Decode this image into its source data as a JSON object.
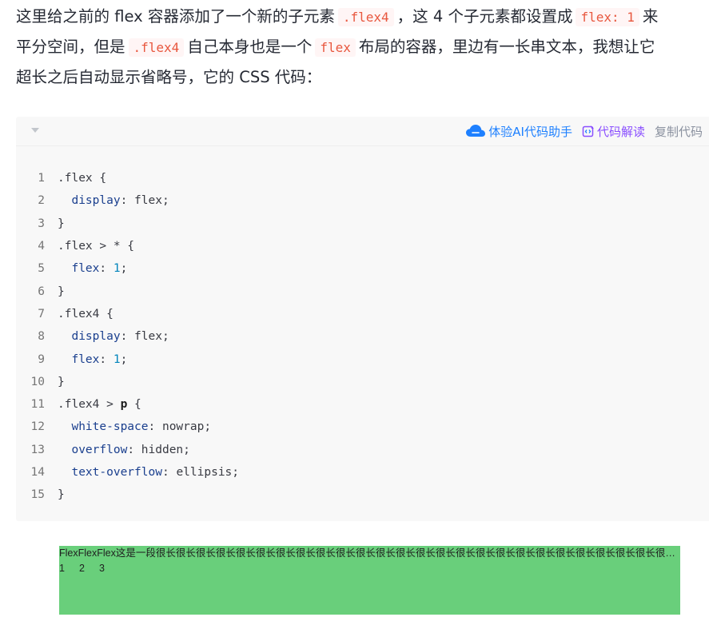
{
  "article": {
    "line1": {
      "t1": "这里给之前的 flex 容器添加了一个新的子元素",
      "code1": ".flex4",
      "t2": "，这 4 个子元素都设置成",
      "code2": "flex: 1",
      "t3": "来"
    },
    "line2": {
      "t1": "平分空间，但是",
      "code1": ".flex4",
      "t2": "自己本身也是一个",
      "code2": "flex",
      "t3": "布局的容器，里边有一长串文本，我想让它"
    },
    "line3": {
      "t1": "超长之后自动显示省略号，它的 CSS 代码："
    }
  },
  "code_toolbar": {
    "collapse_icon": "caret-down-icon",
    "ai_icon": "cloud-icon",
    "ai_label": "体验AI代码助手",
    "explain_icon": "code-edit-icon",
    "explain_label": "代码解读",
    "copy_label": "复制代码",
    "colors": {
      "ai": "#1e80ff",
      "explain": "#8a4fff",
      "copy": "#8a919f"
    }
  },
  "code": {
    "lines": [
      {
        "n": "1",
        "a": ".flex {"
      },
      {
        "n": "2",
        "ind": "  ",
        "prop": "display",
        "sep": ": ",
        "val": "flex",
        "end": ";"
      },
      {
        "n": "3",
        "a": "}"
      },
      {
        "n": "4",
        "a": ".flex > * {"
      },
      {
        "n": "5",
        "ind": "  ",
        "prop": "flex",
        "sep": ": ",
        "num": "1",
        "end": ";"
      },
      {
        "n": "6",
        "a": "}"
      },
      {
        "n": "7",
        "a": ".flex4 {"
      },
      {
        "n": "8",
        "ind": "  ",
        "prop": "display",
        "sep": ": ",
        "val": "flex",
        "end": ";"
      },
      {
        "n": "9",
        "ind": "  ",
        "prop": "flex",
        "sep": ": ",
        "num": "1",
        "end": ";"
      },
      {
        "n": "10",
        "a": "}"
      },
      {
        "n": "11",
        "a": ".flex4 > ",
        "tag": "p",
        "b": " {"
      },
      {
        "n": "12",
        "ind": "  ",
        "prop": "white-space",
        "sep": ": ",
        "val": "nowrap",
        "end": ";"
      },
      {
        "n": "13",
        "ind": "  ",
        "prop": "overflow",
        "sep": ": ",
        "val": "hidden",
        "end": ";"
      },
      {
        "n": "14",
        "ind": "  ",
        "prop": "text-overflow",
        "sep": ": ",
        "val": "ellipsis",
        "end": ";"
      },
      {
        "n": "15",
        "a": "}"
      }
    ]
  },
  "demo": {
    "background": "#69cf7b",
    "text": "FlexFlexFlex这是一段很长很长很长很长很长很长很长很长很长很长很长很长很长很长很长很长很长很长很长很长很长很长很长很长很长很长很长的文本",
    "numbers": [
      "1",
      "2",
      "3"
    ]
  }
}
